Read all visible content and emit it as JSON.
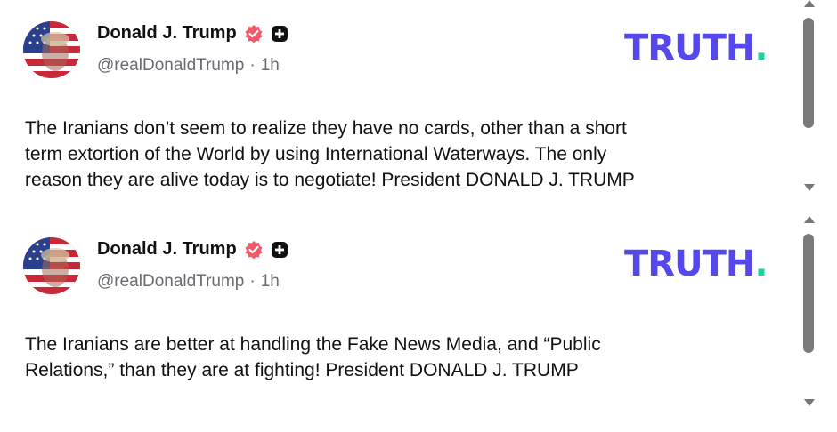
{
  "posts": [
    {
      "author_name": "Donald J. Trump",
      "handle": "@realDonaldTrump",
      "separator": "·",
      "time": "1h",
      "logo_text": "TRUTH",
      "logo_dot": ".",
      "text": "The Iranians don’t seem to realize they have no cards, other than a short\nterm extortion of the World by using International Waterways. The only\nreason they are alive today is to negotiate! President DONALD J. TRUMP",
      "verified_icon": "verified-badge-icon",
      "plus_icon": "plus-badge-icon"
    },
    {
      "author_name": "Donald J. Trump",
      "handle": "@realDonaldTrump",
      "separator": "·",
      "time": "1h",
      "logo_text": "TRUTH",
      "logo_dot": ".",
      "text": "The Iranians are better at handling the Fake News Media, and “Public\nRelations,” than they are at fighting! President DONALD J. TRUMP",
      "verified_icon": "verified-badge-icon",
      "plus_icon": "plus-badge-icon"
    }
  ],
  "colors": {
    "brand": "#5448ee",
    "brand_dot": "#1dd1a1",
    "verified": "#f05a6a",
    "muted": "#6b6b73"
  }
}
